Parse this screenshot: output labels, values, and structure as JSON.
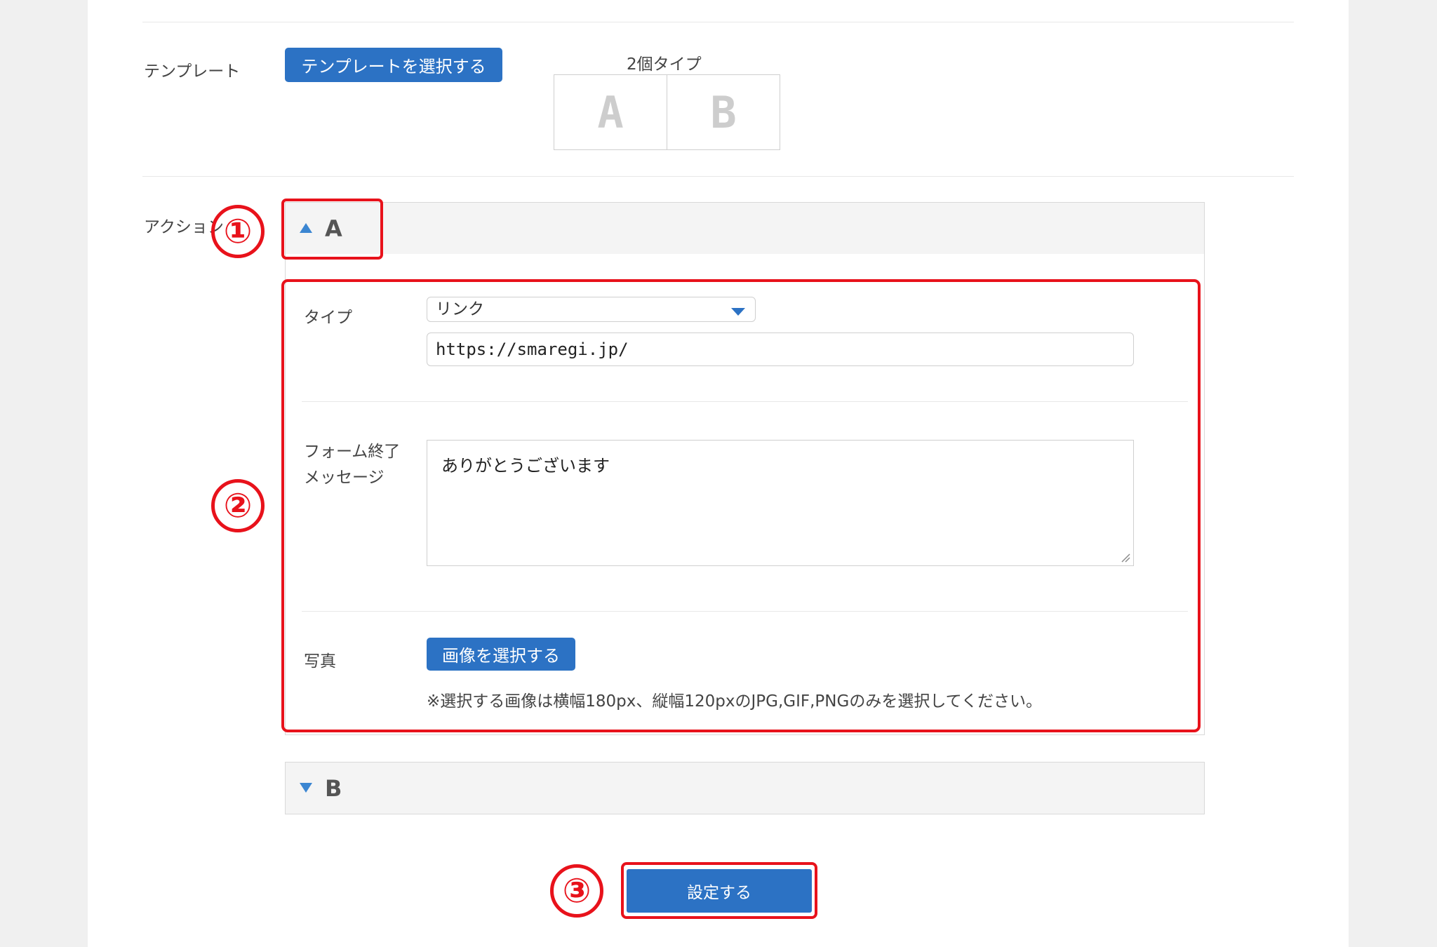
{
  "template": {
    "label": "テンプレート",
    "select_button": "テンプレートを選択する",
    "caption": "2個タイプ",
    "cells": [
      "A",
      "B"
    ]
  },
  "action": {
    "label": "アクション",
    "panel_a": {
      "title": "A",
      "type_label": "タイプ",
      "type_value": "リンク",
      "url_value": "https://smaregi.jp/",
      "message_label_line1": "フォーム終了",
      "message_label_line2": "メッセージ",
      "message_value": "ありがとうございます",
      "photo_label": "写真",
      "image_button": "画像を選択する",
      "image_note": "※選択する画像は横幅180px、縦幅120pxのJPG,GIF,PNGのみを選択してください。"
    },
    "panel_b": {
      "title": "B"
    }
  },
  "submit_button": "設定する",
  "callouts": [
    "①",
    "②",
    "③"
  ],
  "colors": {
    "primary": "#2c72c4",
    "highlight": "#e8121b",
    "triangle": "#3b86d2"
  }
}
